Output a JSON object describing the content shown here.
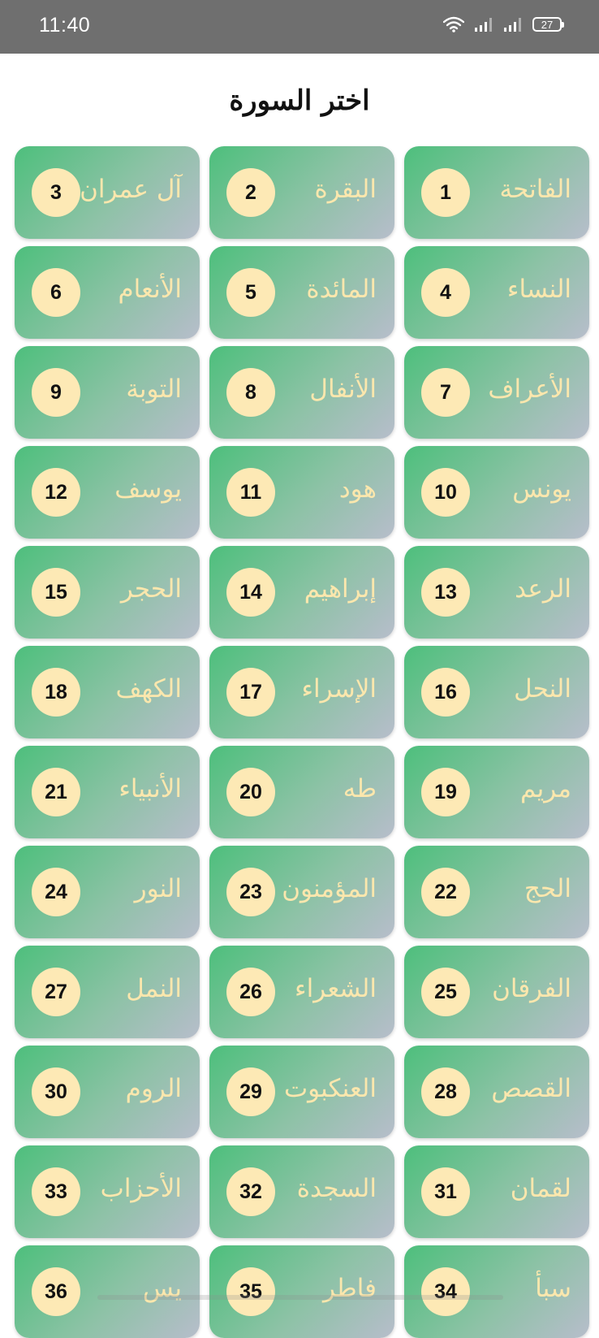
{
  "status_bar": {
    "time": "11:40",
    "battery": "27",
    "icons": [
      "wifi-icon",
      "signal-icon",
      "signal-icon",
      "battery-icon"
    ]
  },
  "title": "اختر السورة",
  "surahs": [
    {
      "number": "1",
      "name": "الفاتحة"
    },
    {
      "number": "2",
      "name": "البقرة"
    },
    {
      "number": "3",
      "name": "آل عمران"
    },
    {
      "number": "4",
      "name": "النساء"
    },
    {
      "number": "5",
      "name": "المائدة"
    },
    {
      "number": "6",
      "name": "الأنعام"
    },
    {
      "number": "7",
      "name": "الأعراف"
    },
    {
      "number": "8",
      "name": "الأنفال"
    },
    {
      "number": "9",
      "name": "التوبة"
    },
    {
      "number": "10",
      "name": "يونس"
    },
    {
      "number": "11",
      "name": "هود"
    },
    {
      "number": "12",
      "name": "يوسف"
    },
    {
      "number": "13",
      "name": "الرعد"
    },
    {
      "number": "14",
      "name": "إبراهيم"
    },
    {
      "number": "15",
      "name": "الحجر"
    },
    {
      "number": "16",
      "name": "النحل"
    },
    {
      "number": "17",
      "name": "الإسراء"
    },
    {
      "number": "18",
      "name": "الكهف"
    },
    {
      "number": "19",
      "name": "مريم"
    },
    {
      "number": "20",
      "name": "طه"
    },
    {
      "number": "21",
      "name": "الأنبياء"
    },
    {
      "number": "22",
      "name": "الحج"
    },
    {
      "number": "23",
      "name": "المؤمنون"
    },
    {
      "number": "24",
      "name": "النور"
    },
    {
      "number": "25",
      "name": "الفرقان"
    },
    {
      "number": "26",
      "name": "الشعراء"
    },
    {
      "number": "27",
      "name": "النمل"
    },
    {
      "number": "28",
      "name": "القصص"
    },
    {
      "number": "29",
      "name": "العنكبوت"
    },
    {
      "number": "30",
      "name": "الروم"
    },
    {
      "number": "31",
      "name": "لقمان"
    },
    {
      "number": "32",
      "name": "السجدة"
    },
    {
      "number": "33",
      "name": "الأحزاب"
    },
    {
      "number": "34",
      "name": "سبأ"
    },
    {
      "number": "35",
      "name": "فاطر"
    },
    {
      "number": "36",
      "name": "يس"
    }
  ],
  "colors": {
    "status_bar": "#6f6f6f",
    "card_gradient_start": "#4dbf7c",
    "card_gradient_end": "#b7bdcb",
    "badge": "#fde9b5",
    "name_text": "#fbe7ad"
  }
}
